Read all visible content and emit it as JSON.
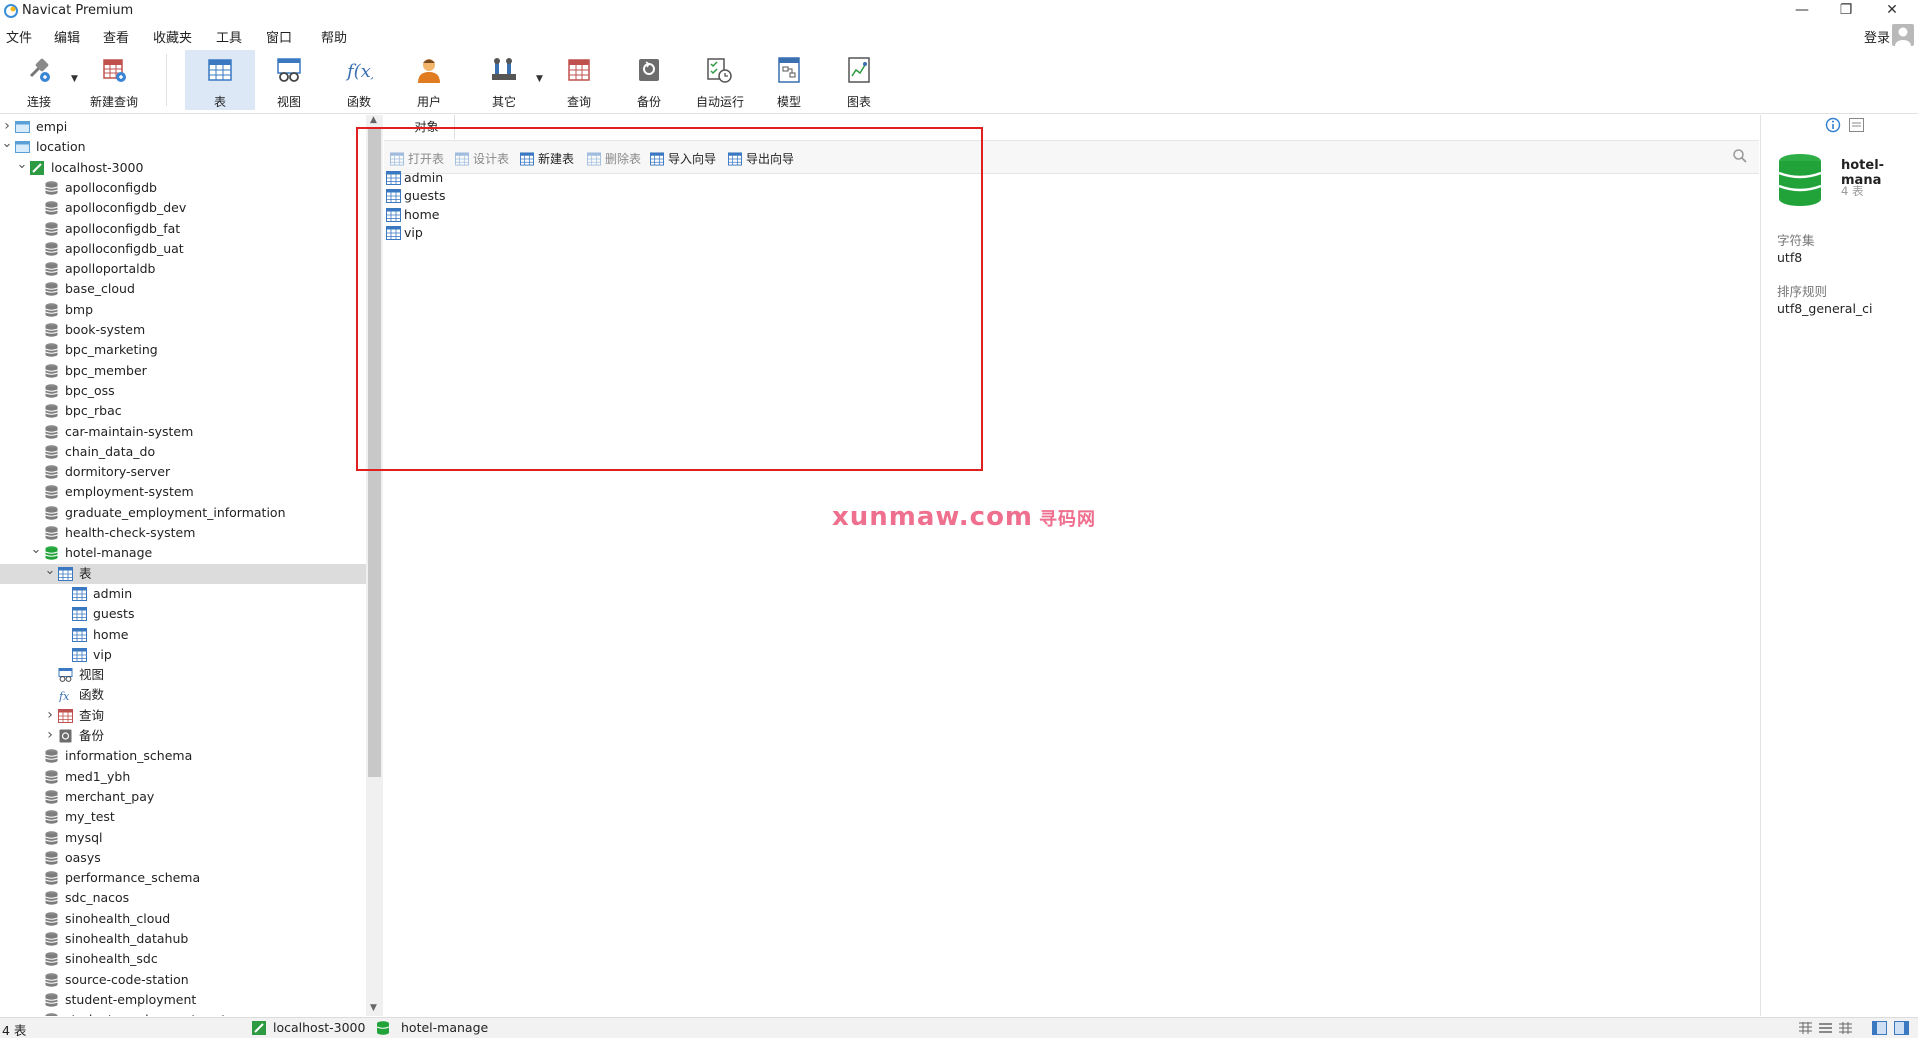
{
  "window": {
    "title": "Navicat Premium",
    "controls": [
      "—",
      "❐",
      "✕"
    ]
  },
  "menu": {
    "items": [
      "文件",
      "编辑",
      "查看",
      "收藏夹",
      "工具",
      "窗口",
      "帮助"
    ],
    "login": "登录"
  },
  "toolbar": {
    "items": [
      {
        "label": "连接",
        "icon": "connect-icon"
      },
      {
        "label": "新建查询",
        "icon": "new-query-icon"
      },
      {
        "label": "表",
        "icon": "table-icon"
      },
      {
        "label": "视图",
        "icon": "view-icon"
      },
      {
        "label": "函数",
        "icon": "function-icon"
      },
      {
        "label": "用户",
        "icon": "user-icon"
      },
      {
        "label": "其它",
        "icon": "tools-icon"
      },
      {
        "label": "查询",
        "icon": "query-icon"
      },
      {
        "label": "备份",
        "icon": "backup-icon"
      },
      {
        "label": "自动运行",
        "icon": "schedule-icon"
      },
      {
        "label": "模型",
        "icon": "model-icon"
      },
      {
        "label": "图表",
        "icon": "chart-icon"
      }
    ],
    "active_index": 2
  },
  "tree": {
    "top_items": [
      "empi",
      "location"
    ],
    "connection": "localhost-3000",
    "databases_before": [
      "apolloconfigdb",
      "apolloconfigdb_dev",
      "apolloconfigdb_fat",
      "apolloconfigdb_uat",
      "apolloportaldb",
      "base_cloud",
      "bmp",
      "book-system",
      "bpc_marketing",
      "bpc_member",
      "bpc_oss",
      "bpc_rbac",
      "car-maintain-system",
      "chain_data_do",
      "dormitory-server",
      "employment-system",
      "graduate_employment_information",
      "health-check-system"
    ],
    "open_db": "hotel-manage",
    "tables_folder": "表",
    "tables": [
      "admin",
      "guests",
      "home",
      "vip"
    ],
    "other_folders": [
      "视图",
      "函数",
      "查询",
      "备份"
    ],
    "databases_after": [
      "information_schema",
      "med1_ybh",
      "merchant_pay",
      "my_test",
      "mysql",
      "oasys",
      "performance_schema",
      "sdc_nacos",
      "sinohealth_cloud",
      "sinohealth_datahub",
      "sinohealth_sdc",
      "source-code-station",
      "student-employment",
      "student-employment-system"
    ]
  },
  "main": {
    "tab": "对象",
    "actions": [
      {
        "label": "打开表",
        "enabled": false
      },
      {
        "label": "设计表",
        "enabled": false
      },
      {
        "label": "新建表",
        "enabled": true
      },
      {
        "label": "删除表",
        "enabled": false
      },
      {
        "label": "导入向导",
        "enabled": true
      },
      {
        "label": "导出向导",
        "enabled": true
      }
    ],
    "objects": [
      "admin",
      "guests",
      "home",
      "vip"
    ],
    "watermark": "xunmaw.com",
    "watermark_cn": "寻码网"
  },
  "info": {
    "db_name": "hotel-mana",
    "count": "4 表",
    "charset_label": "字符集",
    "charset": "utf8",
    "collation_label": "排序规则",
    "collation": "utf8_general_ci"
  },
  "status": {
    "count": "4 表",
    "connection": "localhost-3000",
    "database": "hotel-manage"
  },
  "colors": {
    "accent": "#dce8f6",
    "db_green": "#22a33a",
    "highlight": "#e02020",
    "watermark": "#ef6f8e"
  }
}
